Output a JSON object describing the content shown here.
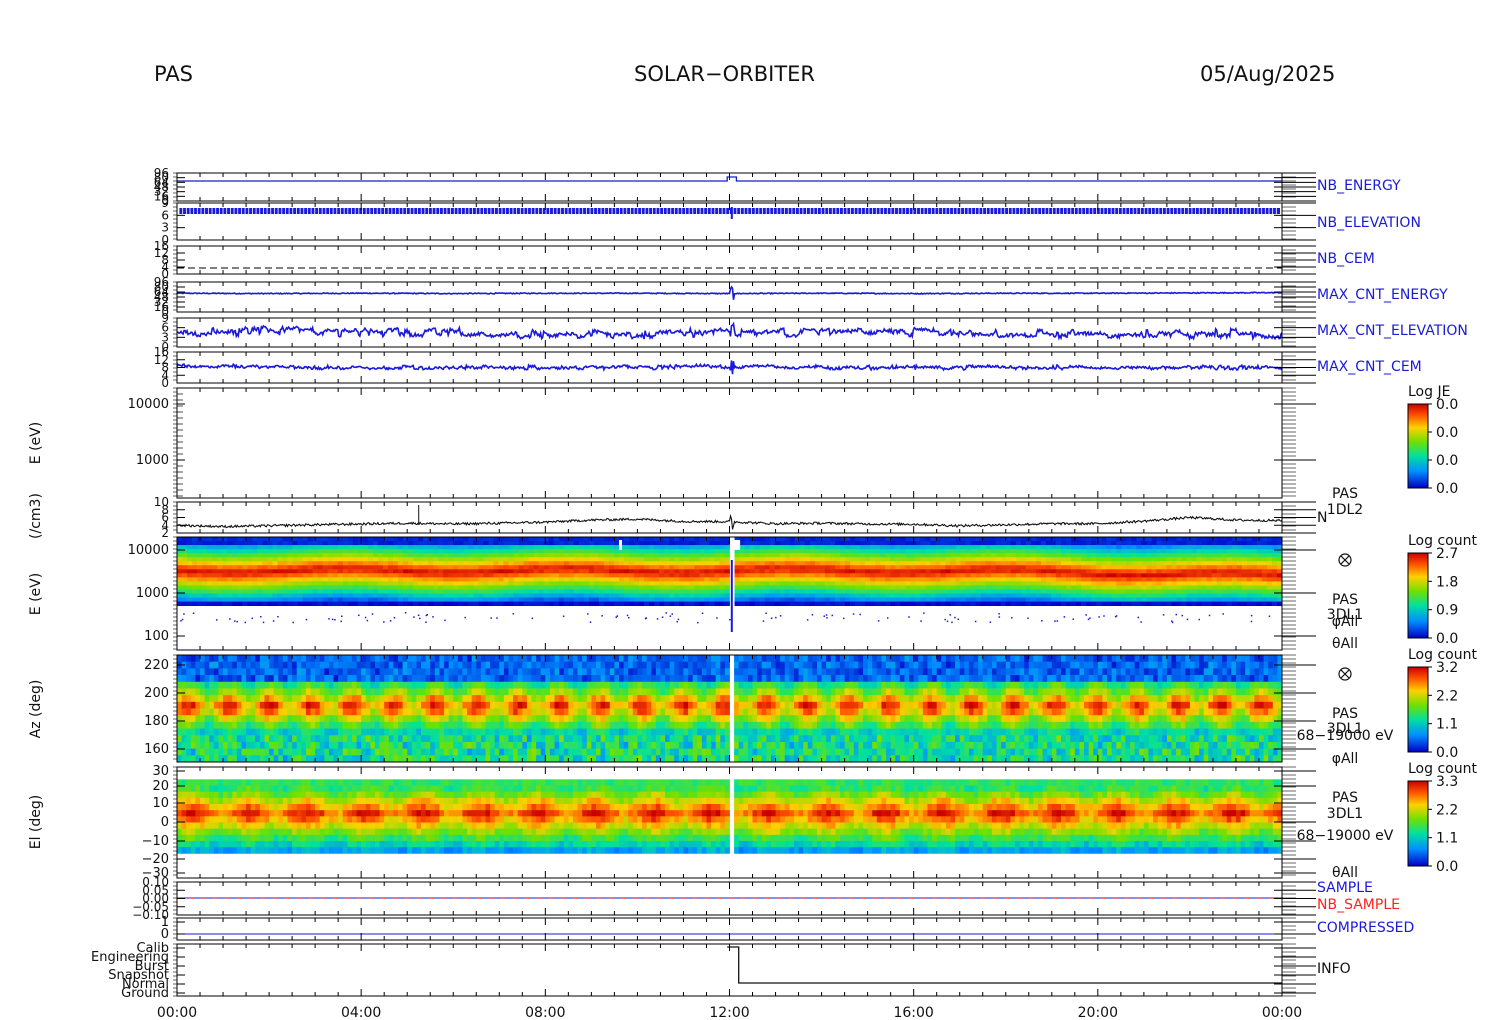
{
  "header": {
    "left": "PAS",
    "center": "SOLAR−ORBITER",
    "right": "05/Aug/2025"
  },
  "time_axis": {
    "ticks": [
      "00:00",
      "04:00",
      "08:00",
      "12:00",
      "16:00",
      "20:00",
      "00:00"
    ],
    "range_hours": [
      0,
      24
    ]
  },
  "colors": {
    "series_blue": "#1a1ad8",
    "sample_red": "#ff2020",
    "frame": "#000000"
  },
  "chart_data": [
    {
      "type": "line",
      "panel": "NB_ENERGY",
      "label": "NB_ENERGY",
      "label_color": "#1a1ad8",
      "y_ticks": [
        "96",
        "80",
        "64",
        "48",
        "32",
        "16",
        "0"
      ],
      "x_hours": [
        0,
        11.9,
        11.95,
        12.15,
        12.2,
        24
      ],
      "values": [
        0.1,
        0.1,
        0.7,
        0.7,
        0.1,
        0.1
      ],
      "ylim": [
        0,
        1
      ]
    },
    {
      "type": "line",
      "panel": "NB_ELEVATION",
      "label": "NB_ELEVATION",
      "label_color": "#1a1ad8",
      "y_ticks": [
        "9",
        "6",
        "3",
        "0"
      ],
      "style": "dense-band",
      "band_value": 7,
      "ylim": [
        0,
        10
      ]
    },
    {
      "type": "line",
      "panel": "NB_CEM",
      "label": "NB_CEM",
      "label_color": "#1a1ad8",
      "y_ticks": [
        "16",
        "12",
        "8",
        "4",
        "0"
      ],
      "style": "dashed",
      "level": 5,
      "ylim": [
        0,
        16
      ]
    },
    {
      "type": "line",
      "panel": "MAX_CNT_ENERGY",
      "label": "MAX_CNT_ENERGY",
      "label_color": "#1a1ad8",
      "y_ticks": [
        "96",
        "80",
        "64",
        "48",
        "32",
        "16",
        "0"
      ],
      "style": "noisy",
      "x_hours": [
        0,
        2,
        4,
        6,
        8,
        10,
        12,
        14,
        16,
        18,
        20,
        22,
        24
      ],
      "values": [
        36,
        35,
        36,
        35,
        36,
        36,
        35,
        36,
        35,
        36,
        36,
        37,
        38
      ],
      "ylim": [
        0,
        96
      ]
    },
    {
      "type": "line",
      "panel": "MAX_CNT_ELEVATION",
      "label": "MAX_CNT_ELEVATION",
      "label_color": "#1a1ad8",
      "y_ticks": [
        "9",
        "6",
        "3",
        "0"
      ],
      "style": "noisy-steps",
      "x_hours": [
        0,
        2,
        4,
        6,
        8,
        10,
        12,
        14,
        16,
        18,
        20,
        22,
        24
      ],
      "values": [
        5,
        5.5,
        5,
        5,
        4.5,
        4.5,
        5,
        5,
        5,
        4.5,
        4.5,
        4.5,
        4.5
      ],
      "ylim": [
        0,
        10
      ]
    },
    {
      "type": "line",
      "panel": "MAX_CNT_CEM",
      "label": "MAX_CNT_CEM",
      "label_color": "#1a1ad8",
      "y_ticks": [
        "16",
        "12",
        "8",
        "4",
        "0"
      ],
      "style": "noisy-steps",
      "x_hours": [
        0,
        2,
        4,
        6,
        8,
        10,
        12,
        14,
        16,
        18,
        20,
        22,
        24
      ],
      "values": [
        9,
        8.5,
        8,
        8,
        8,
        8,
        8.5,
        8,
        8,
        8,
        8,
        8,
        8
      ],
      "ylim": [
        0,
        16
      ]
    },
    {
      "type": "heatmap",
      "panel": "E-empty",
      "ylabel": "E (eV)",
      "y_ticks": [
        "10000",
        "1000"
      ],
      "scale": "log",
      "colorbar": {
        "title": "Log JE",
        "ticks": [
          "0.0",
          "0.0",
          "0.0",
          "0.0"
        ]
      }
    },
    {
      "type": "line",
      "panel": "N",
      "ylabel": "(/cm3)",
      "label": "N",
      "side_text": [
        "PAS",
        "1DL2"
      ],
      "y_ticks": [
        "10",
        "8",
        "6",
        "4",
        "2"
      ],
      "ylim": [
        0,
        12
      ],
      "x_hours": [
        0,
        1,
        2,
        3,
        4,
        5,
        6,
        7,
        8,
        9,
        10,
        11,
        12,
        13,
        14,
        15,
        16,
        17,
        18,
        19,
        20,
        21,
        22,
        23,
        24
      ],
      "values": [
        3.0,
        2.5,
        2.8,
        3.2,
        3.5,
        3.8,
        3.5,
        3.8,
        4.2,
        5.0,
        5.4,
        4.5,
        4.4,
        3.6,
        3.8,
        3.5,
        3.4,
        2.8,
        3.2,
        3.6,
        3.6,
        4.6,
        6.0,
        5.0,
        4.8
      ]
    },
    {
      "type": "heatmap",
      "panel": "E-spectrogram",
      "ylabel": "E (eV)",
      "y_ticks": [
        "10000",
        "1000",
        "100"
      ],
      "scale": "log",
      "side_text": [
        "PAS",
        "3DL1",
        "φAll",
        "θAll"
      ],
      "colorbar": {
        "title": "Log count",
        "ticks": [
          "2.7",
          "1.8",
          "0.9",
          "0.0"
        ]
      }
    },
    {
      "type": "heatmap",
      "panel": "Az",
      "ylabel": "Az (deg)",
      "y_ticks": [
        "220",
        "200",
        "180",
        "160"
      ],
      "side_text": [
        "PAS",
        "3DL1",
        "68−19000 eV",
        "φAll"
      ],
      "colorbar": {
        "title": "Log count",
        "ticks": [
          "3.2",
          "2.2",
          "1.1",
          "0.0"
        ]
      }
    },
    {
      "type": "heatmap",
      "panel": "El",
      "ylabel": "El (deg)",
      "y_ticks": [
        "30",
        "20",
        "10",
        "0",
        "−10",
        "−20",
        "−30"
      ],
      "side_text": [
        "PAS",
        "3DL1",
        "68−19000 eV",
        "θAll"
      ],
      "colorbar": {
        "title": "Log count",
        "ticks": [
          "3.3",
          "2.2",
          "1.1",
          "0.0"
        ]
      }
    },
    {
      "type": "line",
      "panel": "SAMPLE",
      "y_ticks": [
        "0.10",
        "0.05",
        "0.00",
        "−0.05",
        "−0.10"
      ],
      "labels": [
        {
          "text": "SAMPLE",
          "color": "#1a1ad8"
        },
        {
          "text": "NB_SAMPLE",
          "color": "#ff2020"
        }
      ]
    },
    {
      "type": "line",
      "panel": "COMPRESSED",
      "label": "COMPRESSED",
      "label_color": "#1a1ad8",
      "y_ticks": [
        "1",
        "0"
      ],
      "x_hours": [
        0,
        24
      ],
      "values": [
        0,
        0
      ],
      "ylim": [
        0,
        1
      ]
    },
    {
      "type": "line",
      "panel": "INFO",
      "label": "INFO",
      "label_color": "#111111",
      "y_ticks": [
        "Calib",
        "Engineering",
        "Burst",
        "Snapshot",
        "Normal",
        "Ground"
      ],
      "x_hours": [
        11.9,
        12.2,
        12.2,
        24
      ],
      "values": [
        5,
        5,
        1,
        1
      ],
      "ylim": [
        0,
        5
      ]
    }
  ]
}
